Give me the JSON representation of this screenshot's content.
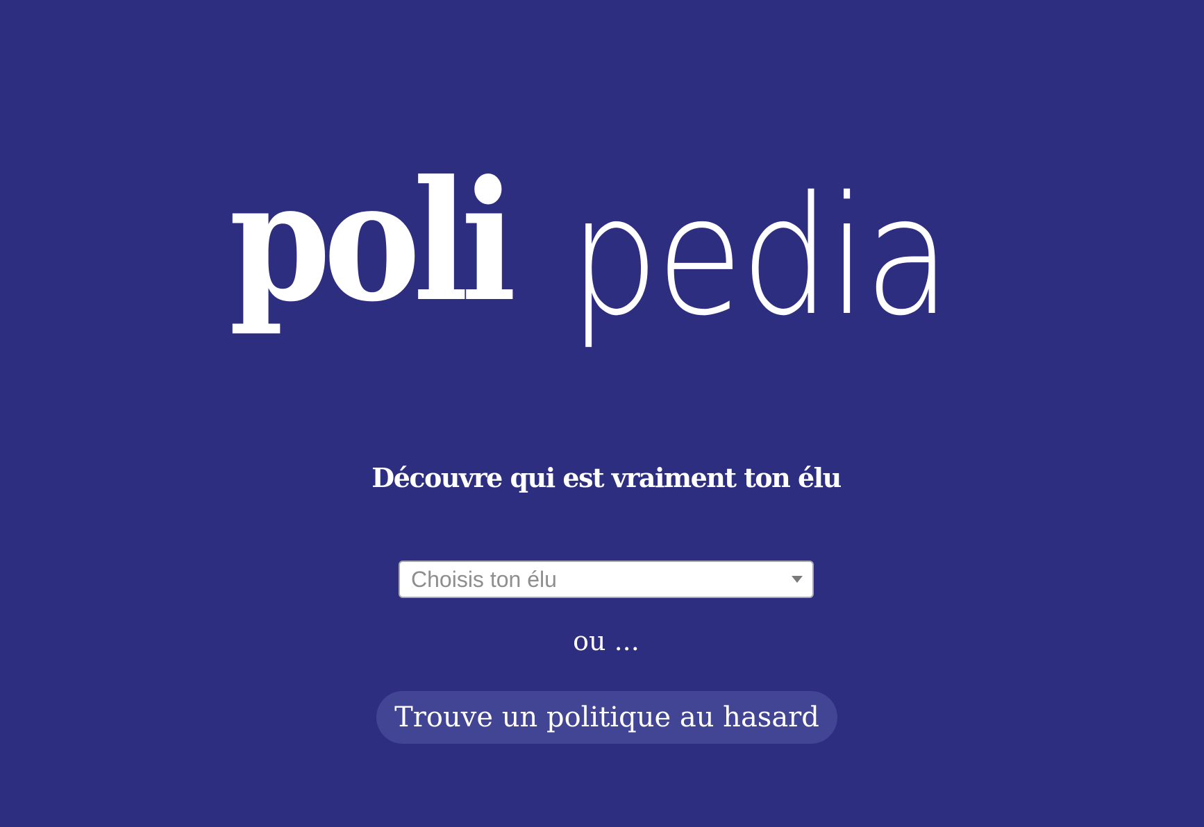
{
  "logo": {
    "part_bold": "poli",
    "part_light": "pedia"
  },
  "tagline": "Découvre qui est vraiment ton élu",
  "select": {
    "placeholder": "Choisis ton élu",
    "icon": "chevron-down-icon"
  },
  "separator_text": "ou ...",
  "random_button_label": "Trouve un politique au hasard",
  "colors": {
    "background": "#2d2e80",
    "button_background": "#424593",
    "text": "#ffffff"
  }
}
